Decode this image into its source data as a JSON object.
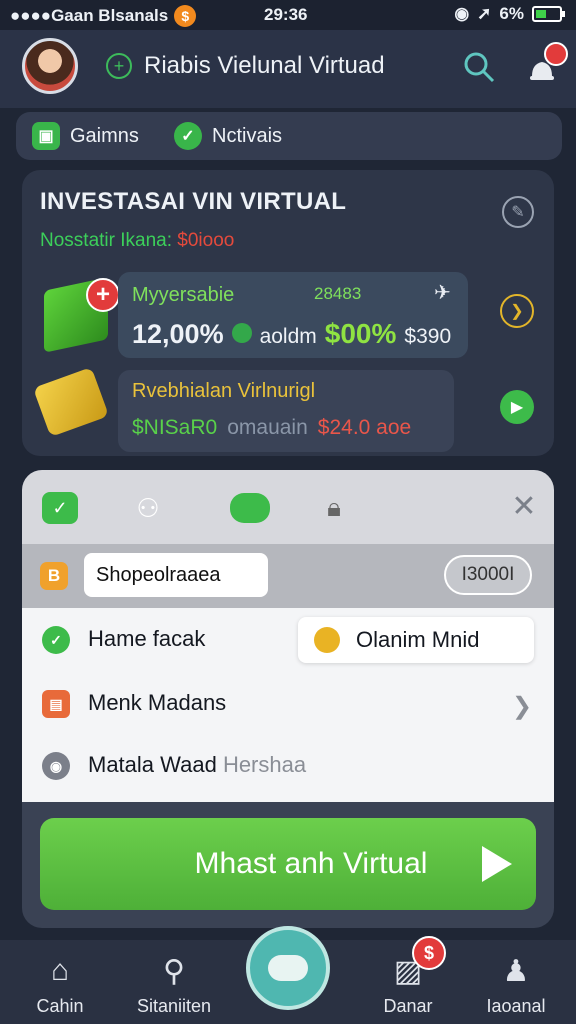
{
  "status_bar": {
    "carrier": "●●●●Gaan Blsanals",
    "carrier_icon": "dollar-coin-icon",
    "time": "29:36",
    "battery_text": "6%"
  },
  "header": {
    "title": "Riabis Vielunal Virtuad",
    "title_icon": "plus-circle-icon",
    "search_icon": "search-icon",
    "bell_icon": "bell-icon"
  },
  "tabs": [
    {
      "label": "Gaimns",
      "icon": "book-icon"
    },
    {
      "label": "Nctivais",
      "icon": "check-icon"
    }
  ],
  "invest": {
    "title": "INVESTASAI VIN VIRTUAL",
    "subtitle": "Nosstatir Ikana: ",
    "subtitle_amount": "$0iooo",
    "card1": {
      "name": "Myyersabie",
      "code": "28483",
      "percent": "12,00%",
      "label": "aoldm",
      "value": "$00%",
      "small_value": "$390"
    },
    "card2": {
      "name": "Rvebhialan Virlnurigl",
      "green_value": "$NISaR0",
      "muted_value": "omauain",
      "red_value": "$24.0 aoe"
    }
  },
  "sheet": {
    "search_value": "Shopeolraaea",
    "count": "I3000I",
    "items": [
      {
        "label": "Hame facak"
      },
      {
        "label": "Menk Madans"
      },
      {
        "label": "Matala Waad",
        "muted": "Hershaa"
      }
    ],
    "option_label": "Olanim Mnid",
    "cta_label": "Mhast anh Virtual"
  },
  "nav": [
    {
      "label": "Cahin",
      "icon": "home-icon"
    },
    {
      "label": "Sitaniiten",
      "icon": "user-icon"
    },
    {
      "label": "",
      "icon": "cloud-icon"
    },
    {
      "label": "Danar",
      "icon": "wallet-icon"
    },
    {
      "label": "Iaoanal",
      "icon": "profile-icon"
    }
  ],
  "colors": {
    "accent_green": "#4eb038",
    "alert_red": "#e23b3b",
    "gold": "#e9c23b"
  }
}
